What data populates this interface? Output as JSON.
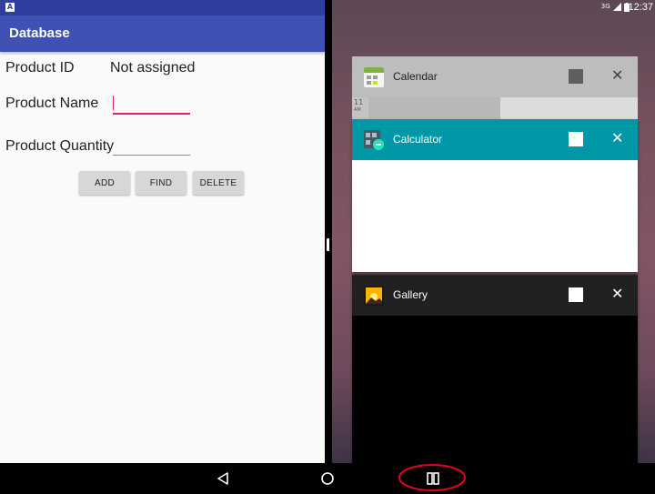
{
  "left_app": {
    "status_badge": "A",
    "title": "Database",
    "product_id_label": "Product ID",
    "product_id_value": "Not assigned",
    "product_name_label": "Product Name",
    "product_name_value": "",
    "product_quantity_label": "Product Quantity",
    "product_quantity_value": "",
    "buttons": {
      "add": "ADD",
      "find": "FIND",
      "delete": "DELETE"
    }
  },
  "right_status": {
    "network": "3G",
    "clock": "12:37"
  },
  "recents": {
    "calendar": {
      "name": "Calendar",
      "preview_hour": "11",
      "preview_ampm": "AM"
    },
    "calculator": {
      "name": "Calculator"
    },
    "gallery": {
      "name": "Gallery"
    }
  },
  "colors": {
    "app_bar": "#3f51b5",
    "status_bar": "#303f9f",
    "accent": "#e91e63",
    "calculator_header": "#0097a7",
    "highlight_circle": "#e5001b"
  }
}
